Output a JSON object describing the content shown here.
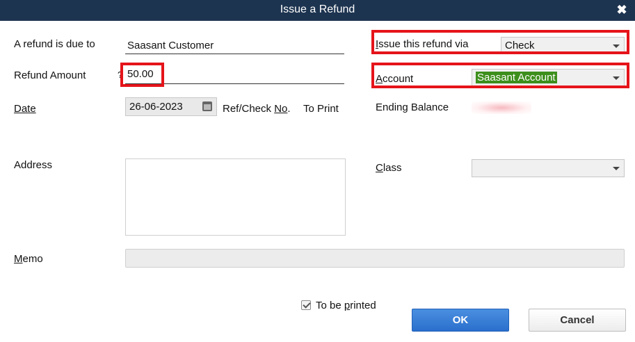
{
  "window": {
    "title": "Issue a Refund",
    "close_glyph": "✖"
  },
  "form": {
    "refund_due_to_label": "A refund is due to",
    "refund_due_to_value": "Saasant Customer",
    "refund_amount_label": "Refund Amount",
    "refund_amount_help": "?",
    "refund_amount_value": "50.00",
    "date_label": "Date",
    "date_value": "26-06-2023",
    "ref_check_label_pre": "Ref/Check ",
    "ref_check_label_u": "No",
    "ref_check_label_post": ".",
    "ref_check_value": "To Print",
    "address_label": "Address",
    "memo_label_u": "M",
    "memo_label_rest": "emo",
    "issue_via_label_u": "I",
    "issue_via_label_rest": "ssue this refund via",
    "issue_via_value": "Check",
    "account_label_u": "A",
    "account_label_rest": "ccount",
    "account_value": "Saasant Account",
    "ending_balance_label": "Ending Balance",
    "class_label_u": "C",
    "class_label_rest": "lass",
    "class_value": ""
  },
  "footer": {
    "to_be_printed_pre": "To be ",
    "to_be_printed_u": "p",
    "to_be_printed_post": "rinted",
    "to_be_printed_checked": true,
    "ok_label": "OK",
    "cancel_label": "Cancel"
  },
  "colors": {
    "titlebar": "#1d3450",
    "highlight_box": "#e5141a",
    "ok_button": "#2a6fcc",
    "selection": "#3d8f1c"
  }
}
